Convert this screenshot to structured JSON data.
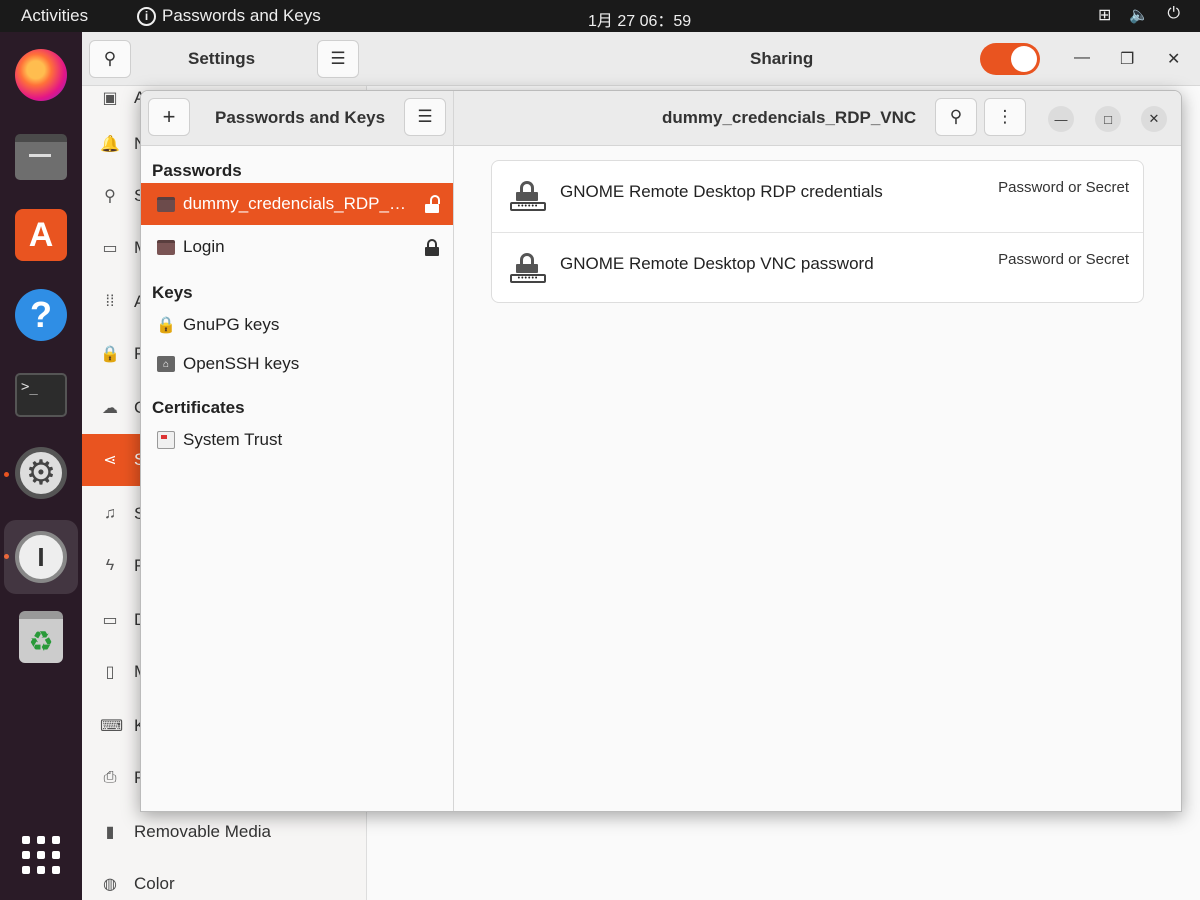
{
  "topbar": {
    "activities": "Activities",
    "app_name": "Passwords and Keys",
    "clock": "1月 27 06：59"
  },
  "settings": {
    "title": "Settings",
    "panel_title": "Sharing",
    "sidebar": [
      {
        "label": "Appearance",
        "icon": "appearance-icon"
      },
      {
        "label": "N",
        "icon": "bell-icon"
      },
      {
        "label": "S",
        "icon": "search-icon"
      },
      {
        "label": "M",
        "icon": "multitask-icon"
      },
      {
        "label": "A",
        "icon": "apps-grid-icon"
      },
      {
        "label": "P",
        "icon": "lock-icon"
      },
      {
        "label": "C",
        "icon": "cloud-icon"
      },
      {
        "label": "S",
        "icon": "share-icon",
        "selected": true
      },
      {
        "label": "S",
        "icon": "music-note-icon"
      },
      {
        "label": "P",
        "icon": "power-icon"
      },
      {
        "label": "D",
        "icon": "display-icon"
      },
      {
        "label": "M",
        "icon": "mouse-icon"
      },
      {
        "label": "K",
        "icon": "keyboard-icon"
      },
      {
        "label": "P",
        "icon": "printer-icon"
      },
      {
        "label": "Removable Media",
        "icon": "usb-icon"
      },
      {
        "label": "Color",
        "icon": "color-icon"
      }
    ]
  },
  "passwords": {
    "title": "Passwords and Keys",
    "subtitle": "dummy_credencials_RDP_VNC",
    "sections": {
      "passwords": "Passwords",
      "keys": "Keys",
      "certificates": "Certificates"
    },
    "keyrings": [
      {
        "label": "dummy_credencials_RDP_VNC",
        "selected": true,
        "locked": false
      },
      {
        "label": "Login",
        "selected": false,
        "locked": true
      }
    ],
    "keys": [
      {
        "label": "GnuPG keys"
      },
      {
        "label": "OpenSSH keys"
      }
    ],
    "certificates": [
      {
        "label": "System Trust"
      }
    ],
    "items": [
      {
        "title": "GNOME Remote Desktop RDP credentials",
        "kind": "Password or Secret"
      },
      {
        "title": "GNOME Remote Desktop VNC password",
        "kind": "Password or Secret"
      }
    ]
  },
  "colors": {
    "accent": "#e95420"
  }
}
